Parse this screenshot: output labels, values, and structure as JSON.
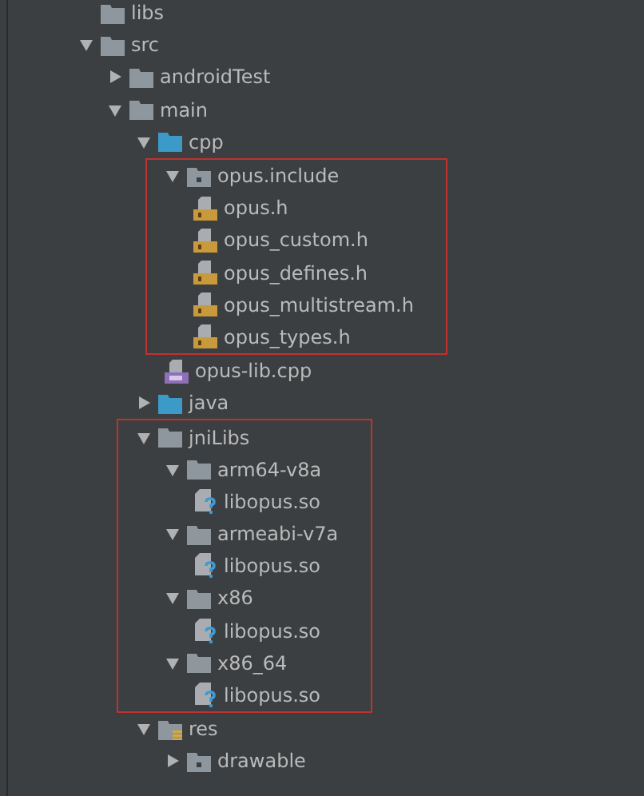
{
  "tree": [
    {
      "label": "libs",
      "kind": "folder"
    },
    {
      "label": "src",
      "kind": "folder",
      "expanded": true,
      "children": [
        {
          "label": "androidTest",
          "kind": "folder",
          "expanded": false
        },
        {
          "label": "main",
          "kind": "folder",
          "expanded": true,
          "children": [
            {
              "label": "cpp",
              "kind": "source-folder",
              "expanded": true,
              "children": [
                {
                  "label": "opus.include",
                  "kind": "package-folder",
                  "expanded": true,
                  "highlighted": true,
                  "children": [
                    {
                      "label": "opus.h",
                      "kind": "header"
                    },
                    {
                      "label": "opus_custom.h",
                      "kind": "header"
                    },
                    {
                      "label": "opus_defines.h",
                      "kind": "header"
                    },
                    {
                      "label": "opus_multistream.h",
                      "kind": "header"
                    },
                    {
                      "label": "opus_types.h",
                      "kind": "header"
                    }
                  ]
                },
                {
                  "label": "opus-lib.cpp",
                  "kind": "cpp"
                }
              ]
            },
            {
              "label": "java",
              "kind": "source-folder",
              "expanded": false
            },
            {
              "label": "jniLibs",
              "kind": "folder",
              "expanded": true,
              "highlighted": true,
              "children": [
                {
                  "label": "arm64-v8a",
                  "kind": "folder",
                  "expanded": true,
                  "children": [
                    {
                      "label": "libopus.so",
                      "kind": "unknown"
                    }
                  ]
                },
                {
                  "label": "armeabi-v7a",
                  "kind": "folder",
                  "expanded": true,
                  "children": [
                    {
                      "label": "libopus.so",
                      "kind": "unknown"
                    }
                  ]
                },
                {
                  "label": "x86",
                  "kind": "folder",
                  "expanded": true,
                  "children": [
                    {
                      "label": "libopus.so",
                      "kind": "unknown"
                    }
                  ]
                },
                {
                  "label": "x86_64",
                  "kind": "folder",
                  "expanded": true,
                  "children": [
                    {
                      "label": "libopus.so",
                      "kind": "unknown"
                    }
                  ]
                }
              ]
            },
            {
              "label": "res",
              "kind": "res-folder",
              "expanded": true,
              "children": [
                {
                  "label": "drawable",
                  "kind": "package-folder",
                  "expanded": false
                }
              ]
            }
          ]
        }
      ]
    }
  ]
}
